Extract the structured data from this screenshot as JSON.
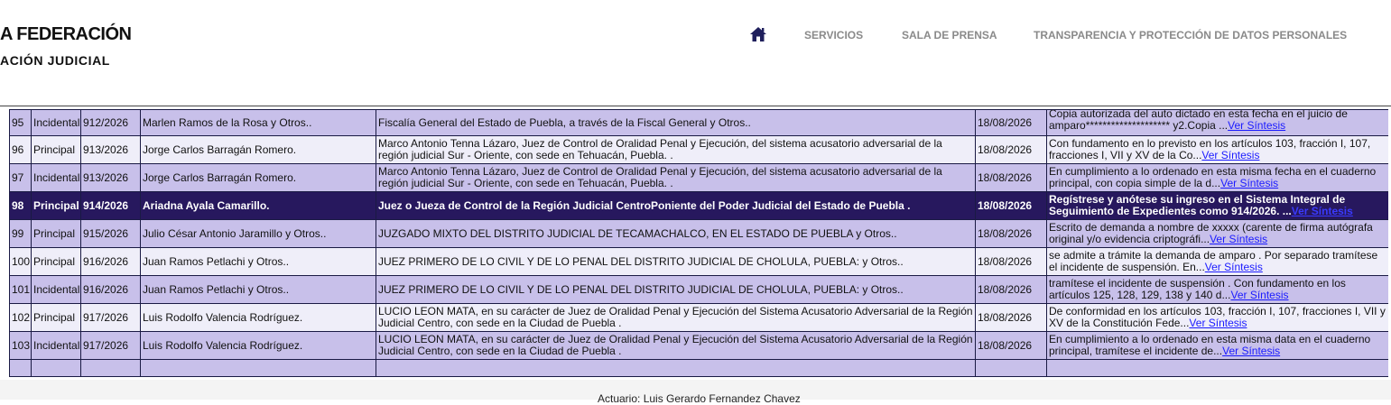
{
  "header": {
    "brand_line1": "A FEDERACIÓN",
    "brand_line2": "ACIÓN JUDICIAL",
    "nav": {
      "home_icon": "home-icon",
      "servicios": "SERVICIOS",
      "sala_de_prensa": "SALA DE PRENSA",
      "transparencia": "TRANSPARENCIA Y PROTECCIÓN DE DATOS PERSONALES"
    }
  },
  "colors": {
    "row_odd": "#c8c0ea",
    "row_even": "#efeef9",
    "row_selected": "#27185e",
    "border": "#1a1a44",
    "link": "#1a1aff",
    "nav_text": "#8a8a8a",
    "home_icon": "#1f1f5c"
  },
  "table": {
    "link_label": "Ver Síntesis",
    "rows": [
      {
        "num": "95",
        "tipo": "Incidental",
        "exp": "912/2026",
        "quejoso": "Marlen Ramos de la Rosa y Otros..",
        "autoridad": "Fiscalía General del Estado de Puebla, a través de la Fiscal General y Otros..",
        "fecha": "18/08/2026",
        "sintesis": "Copia autorizada del auto dictado en esta fecha en el juicio de amparo******************** y2.Copia ..."
      },
      {
        "num": "96",
        "tipo": "Principal",
        "exp": "913/2026",
        "quejoso": "Jorge Carlos Barragán Romero.",
        "autoridad": "Marco Antonio Tenna Lázaro, Juez de Control de Oralidad Penal y Ejecución, del sistema acusatorio adversarial de la región judicial Sur - Oriente, con sede en Tehuacán, Puebla. .",
        "fecha": "18/08/2026",
        "sintesis": "Con fundamento en lo previsto en los artículos 103, fracción I, 107, fracciones I, VII y XV de la Co..."
      },
      {
        "num": "97",
        "tipo": "Incidental",
        "exp": "913/2026",
        "quejoso": "Jorge Carlos Barragán Romero.",
        "autoridad": "Marco Antonio Tenna Lázaro, Juez de Control de Oralidad Penal y Ejecución, del sistema acusatorio adversarial de la región judicial Sur - Oriente, con sede en Tehuacán, Puebla. .",
        "fecha": "18/08/2026",
        "sintesis": "En cumplimiento a lo ordenado en esta misma fecha en el cuaderno principal, con copia simple de la d..."
      },
      {
        "num": "98",
        "tipo": "Principal",
        "exp": "914/2026",
        "quejoso": "Ariadna Ayala Camarillo.",
        "autoridad": "Juez o Jueza de Control de la Región Judicial CentroPoniente del Poder Judicial del Estado de Puebla .",
        "fecha": "18/08/2026",
        "sintesis": "Regístrese y anótese su ingreso en el Sistema Integral de Seguimiento de Expedientes como 914/2026. ..."
      },
      {
        "num": "99",
        "tipo": "Principal",
        "exp": "915/2026",
        "quejoso": "Julio César Antonio Jaramillo y Otros..",
        "autoridad": "JUZGADO MIXTO DEL DISTRITO JUDICIAL DE TECAMACHALCO, EN EL ESTADO DE PUEBLA y Otros..",
        "fecha": "18/08/2026",
        "sintesis": "Escrito de demanda a nombre de xxxxx (carente de firma autógrafa original y/o evidencia criptográfi..."
      },
      {
        "num": "100",
        "tipo": "Principal",
        "exp": "916/2026",
        "quejoso": "Juan Ramos Petlachi y Otros..",
        "autoridad": "JUEZ PRIMERO DE LO CIVIL Y DE LO PENAL DEL DISTRITO JUDICIAL DE CHOLULA, PUEBLA: y Otros..",
        "fecha": "18/08/2026",
        "sintesis": "se admite a trámite la demanda de amparo . Por separado tramítese el incidente de suspensión. En..."
      },
      {
        "num": "101",
        "tipo": "Incidental",
        "exp": "916/2026",
        "quejoso": "Juan Ramos Petlachi y Otros..",
        "autoridad": "JUEZ PRIMERO DE LO CIVIL Y DE LO PENAL DEL DISTRITO JUDICIAL DE CHOLULA, PUEBLA: y Otros..",
        "fecha": "18/08/2026",
        "sintesis": "tramítese el incidente de suspensión . Con fundamento en los artículos 125, 128, 129, 138 y 140 d..."
      },
      {
        "num": "102",
        "tipo": "Principal",
        "exp": "917/2026",
        "quejoso": "Luis Rodolfo Valencia Rodríguez.",
        "autoridad": "LUCIO LEON MATA, en su carácter de Juez de Oralidad Penal y Ejecución del Sistema Acusatorio Adversarial de la Región Judicial Centro, con sede en la Ciudad de Puebla .",
        "fecha": "18/08/2026",
        "sintesis": "De conformidad en los artículos 103, fracción I, 107, fracciones I, VII y XV de la Constitución Fede..."
      },
      {
        "num": "103",
        "tipo": "Incidental",
        "exp": "917/2026",
        "quejoso": "Luis Rodolfo Valencia Rodríguez.",
        "autoridad": "LUCIO LEON MATA, en su carácter de Juez de Oralidad Penal y Ejecución del Sistema Acusatorio Adversarial de la Región Judicial Centro, con sede en la Ciudad de Puebla .",
        "fecha": "18/08/2026",
        "sintesis": "En cumplimiento a lo ordenado en esta misma data en el cuaderno principal, tramítese el incidente de..."
      }
    ]
  },
  "footer": {
    "actuario": "Actuario: Luis Gerardo Fernandez Chavez"
  }
}
